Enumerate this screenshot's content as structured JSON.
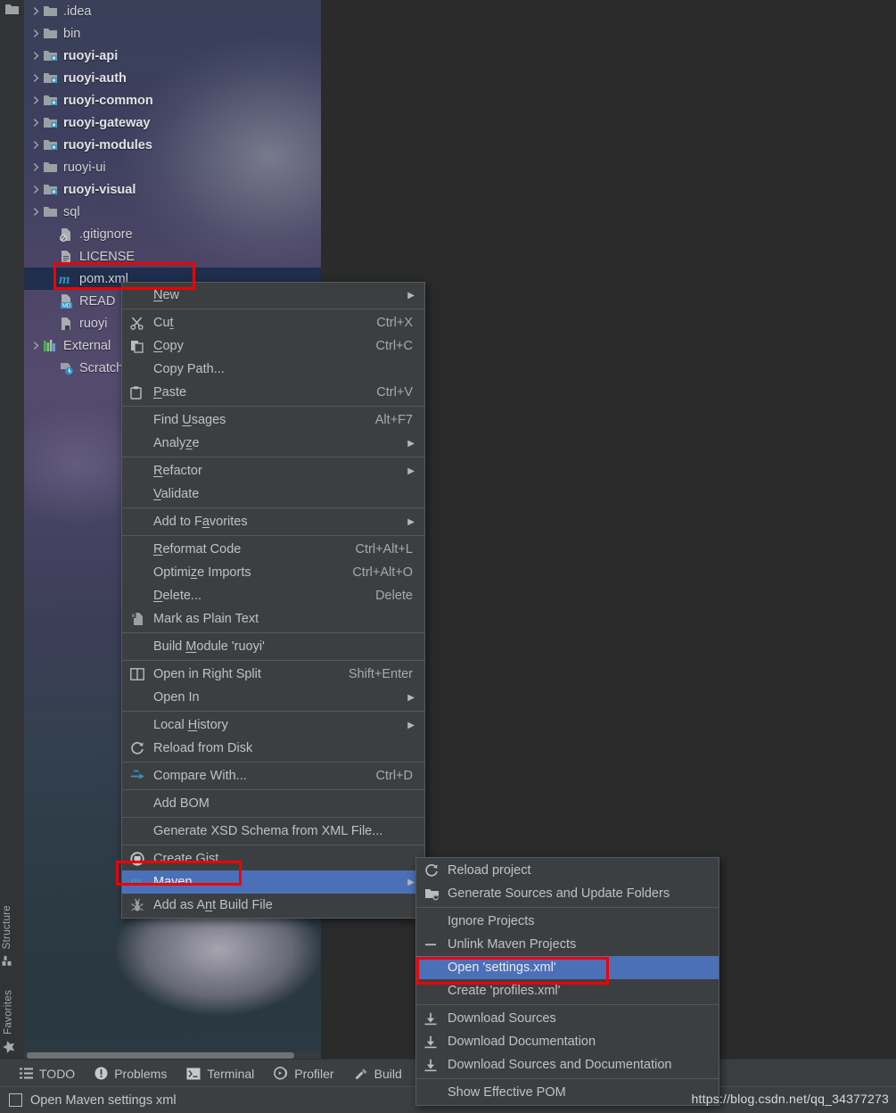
{
  "app": {
    "watermark": "https://blog.csdn.net/qq_34377273"
  },
  "tool_strip": {
    "top_icon": "project-folder-icon",
    "labels": [
      {
        "name": "structure",
        "text": "Structure",
        "icon": "structure-icon"
      },
      {
        "name": "favorites",
        "text": "Favorites",
        "icon": "star-icon"
      }
    ]
  },
  "project_tree": {
    "items": [
      {
        "label": ".idea",
        "icon": "folder-icon",
        "arrow": true,
        "bold": false,
        "selected": false,
        "indent": 0
      },
      {
        "label": "bin",
        "icon": "folder-icon",
        "arrow": true,
        "bold": false,
        "selected": false,
        "indent": 0
      },
      {
        "label": "ruoyi-api",
        "icon": "module-folder-icon",
        "arrow": true,
        "bold": true,
        "selected": false,
        "indent": 0
      },
      {
        "label": "ruoyi-auth",
        "icon": "module-folder-icon",
        "arrow": true,
        "bold": true,
        "selected": false,
        "indent": 0
      },
      {
        "label": "ruoyi-common",
        "icon": "module-folder-icon",
        "arrow": true,
        "bold": true,
        "selected": false,
        "indent": 0
      },
      {
        "label": "ruoyi-gateway",
        "icon": "module-folder-icon",
        "arrow": true,
        "bold": true,
        "selected": false,
        "indent": 0
      },
      {
        "label": "ruoyi-modules",
        "icon": "module-folder-icon",
        "arrow": true,
        "bold": true,
        "selected": false,
        "indent": 0
      },
      {
        "label": "ruoyi-ui",
        "icon": "folder-icon",
        "arrow": true,
        "bold": false,
        "selected": false,
        "indent": 0
      },
      {
        "label": "ruoyi-visual",
        "icon": "module-folder-icon",
        "arrow": true,
        "bold": true,
        "selected": false,
        "indent": 0
      },
      {
        "label": "sql",
        "icon": "folder-icon",
        "arrow": true,
        "bold": false,
        "selected": false,
        "indent": 0
      },
      {
        "label": ".gitignore",
        "icon": "gitignore-file-icon",
        "arrow": false,
        "bold": false,
        "selected": false,
        "indent": 1
      },
      {
        "label": "LICENSE",
        "icon": "text-file-icon",
        "arrow": false,
        "bold": false,
        "selected": false,
        "indent": 1
      },
      {
        "label": "pom.xml",
        "icon": "maven-file-icon",
        "arrow": false,
        "bold": false,
        "selected": true,
        "indent": 1
      },
      {
        "label": "READ",
        "icon": "markdown-file-icon",
        "arrow": false,
        "bold": false,
        "selected": false,
        "indent": 1
      },
      {
        "label": "ruoyi",
        "icon": "image-file-icon",
        "arrow": false,
        "bold": false,
        "selected": false,
        "indent": 1
      },
      {
        "label": "External",
        "icon": "libraries-icon",
        "arrow": true,
        "bold": false,
        "selected": false,
        "indent": 0
      },
      {
        "label": "Scratche",
        "icon": "scratches-icon",
        "arrow": false,
        "bold": false,
        "selected": false,
        "indent": 1
      }
    ]
  },
  "context_menu": {
    "items": [
      {
        "label": "New",
        "mnemonic": "N",
        "shortcut": "",
        "submenu": true,
        "icon": "",
        "separator_after": true,
        "selected": false
      },
      {
        "label": "Cut",
        "mnemonic": "t",
        "shortcut": "Ctrl+X",
        "submenu": false,
        "icon": "scissors-icon",
        "separator_after": false,
        "selected": false
      },
      {
        "label": "Copy",
        "mnemonic": "C",
        "shortcut": "Ctrl+C",
        "submenu": false,
        "icon": "copy-icon",
        "separator_after": false,
        "selected": false
      },
      {
        "label": "Copy Path...",
        "mnemonic": "",
        "shortcut": "",
        "submenu": false,
        "icon": "",
        "separator_after": false,
        "selected": false
      },
      {
        "label": "Paste",
        "mnemonic": "P",
        "shortcut": "Ctrl+V",
        "submenu": false,
        "icon": "clipboard-icon",
        "separator_after": true,
        "selected": false
      },
      {
        "label": "Find Usages",
        "mnemonic": "U",
        "shortcut": "Alt+F7",
        "submenu": false,
        "icon": "",
        "separator_after": false,
        "selected": false
      },
      {
        "label": "Analyze",
        "mnemonic": "z",
        "shortcut": "",
        "submenu": true,
        "icon": "",
        "separator_after": true,
        "selected": false
      },
      {
        "label": "Refactor",
        "mnemonic": "R",
        "shortcut": "",
        "submenu": true,
        "icon": "",
        "separator_after": false,
        "selected": false
      },
      {
        "label": "Validate",
        "mnemonic": "V",
        "shortcut": "",
        "submenu": false,
        "icon": "",
        "separator_after": true,
        "selected": false
      },
      {
        "label": "Add to Favorites",
        "mnemonic": "a",
        "shortcut": "",
        "submenu": true,
        "icon": "",
        "separator_after": true,
        "selected": false
      },
      {
        "label": "Reformat Code",
        "mnemonic": "R",
        "shortcut": "Ctrl+Alt+L",
        "submenu": false,
        "icon": "",
        "separator_after": false,
        "selected": false
      },
      {
        "label": "Optimize Imports",
        "mnemonic": "z",
        "shortcut": "Ctrl+Alt+O",
        "submenu": false,
        "icon": "",
        "separator_after": false,
        "selected": false
      },
      {
        "label": "Delete...",
        "mnemonic": "D",
        "shortcut": "Delete",
        "submenu": false,
        "icon": "",
        "separator_after": false,
        "selected": false
      },
      {
        "label": "Mark as Plain Text",
        "mnemonic": "",
        "shortcut": "",
        "submenu": false,
        "icon": "plain-text-icon",
        "separator_after": true,
        "selected": false
      },
      {
        "label": "Build Module 'ruoyi'",
        "mnemonic": "M",
        "shortcut": "",
        "submenu": false,
        "icon": "",
        "separator_after": true,
        "selected": false
      },
      {
        "label": "Open in Right Split",
        "mnemonic": "",
        "shortcut": "Shift+Enter",
        "submenu": false,
        "icon": "split-icon",
        "separator_after": false,
        "selected": false
      },
      {
        "label": "Open In",
        "mnemonic": "",
        "shortcut": "",
        "submenu": true,
        "icon": "",
        "separator_after": true,
        "selected": false
      },
      {
        "label": "Local History",
        "mnemonic": "H",
        "shortcut": "",
        "submenu": true,
        "icon": "",
        "separator_after": false,
        "selected": false
      },
      {
        "label": "Reload from Disk",
        "mnemonic": "",
        "shortcut": "",
        "submenu": false,
        "icon": "reload-icon",
        "separator_after": true,
        "selected": false
      },
      {
        "label": "Compare With...",
        "mnemonic": "",
        "shortcut": "Ctrl+D",
        "submenu": false,
        "icon": "compare-icon",
        "separator_after": true,
        "selected": false
      },
      {
        "label": "Add BOM",
        "mnemonic": "",
        "shortcut": "",
        "submenu": false,
        "icon": "",
        "separator_after": true,
        "selected": false
      },
      {
        "label": "Generate XSD Schema from XML File...",
        "mnemonic": "",
        "shortcut": "",
        "submenu": false,
        "icon": "",
        "separator_after": true,
        "selected": false
      },
      {
        "label": "Create Gist...",
        "mnemonic": "",
        "shortcut": "",
        "submenu": false,
        "icon": "github-icon",
        "separator_after": false,
        "selected": false
      },
      {
        "label": "Maven",
        "mnemonic": "",
        "shortcut": "",
        "submenu": true,
        "icon": "maven-icon",
        "separator_after": false,
        "selected": true
      },
      {
        "label": "Add as Ant Build File",
        "mnemonic": "n",
        "shortcut": "",
        "submenu": false,
        "icon": "ant-icon",
        "separator_after": false,
        "selected": false
      }
    ]
  },
  "maven_submenu": {
    "items": [
      {
        "label": "Reload project",
        "icon": "reload-icon",
        "separator_after": false,
        "selected": false
      },
      {
        "label": "Generate Sources and Update Folders",
        "icon": "generate-folder-icon",
        "separator_after": true,
        "selected": false
      },
      {
        "label": "Ignore Projects",
        "icon": "",
        "separator_after": false,
        "selected": false
      },
      {
        "label": "Unlink Maven Projects",
        "icon": "minus-icon",
        "separator_after": false,
        "selected": false
      },
      {
        "label": "Open 'settings.xml'",
        "icon": "",
        "separator_after": false,
        "selected": true
      },
      {
        "label": "Create 'profiles.xml'",
        "icon": "",
        "separator_after": true,
        "selected": false
      },
      {
        "label": "Download Sources",
        "icon": "download-icon",
        "separator_after": false,
        "selected": false
      },
      {
        "label": "Download Documentation",
        "icon": "download-icon",
        "separator_after": false,
        "selected": false
      },
      {
        "label": "Download Sources and Documentation",
        "icon": "download-icon",
        "separator_after": true,
        "selected": false
      },
      {
        "label": "Show Effective POM",
        "icon": "",
        "separator_after": false,
        "selected": false
      }
    ]
  },
  "bottom_bar": {
    "items": [
      {
        "label": "TODO",
        "icon": "todo-icon"
      },
      {
        "label": "Problems",
        "icon": "problems-icon"
      },
      {
        "label": "Terminal",
        "icon": "terminal-icon"
      },
      {
        "label": "Profiler",
        "icon": "profiler-icon"
      },
      {
        "label": "Build",
        "icon": "build-icon"
      }
    ]
  },
  "status_bar": {
    "message": "Open Maven settings xml"
  },
  "colors": {
    "menu_bg": "#3c3f41",
    "menu_border": "#565a5c",
    "selection_blue": "#4c70b8",
    "tree_selection": "#16253f",
    "annotation_red": "#f00000",
    "maven_blue": "#3592c4",
    "editor_bg": "#2b2b2b"
  }
}
